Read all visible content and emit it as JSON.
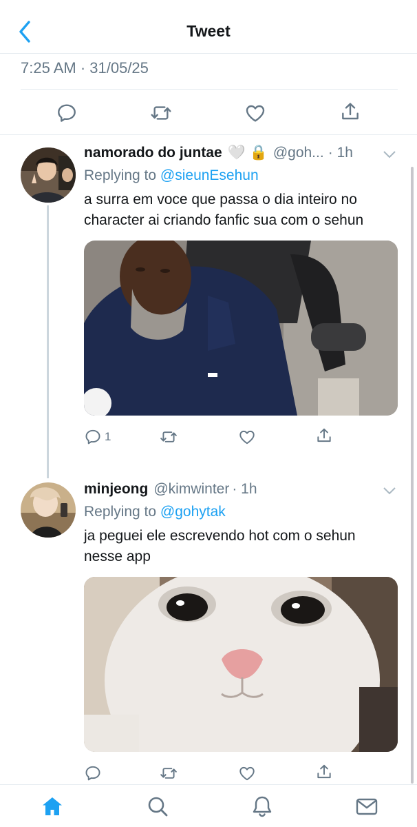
{
  "header": {
    "title": "Tweet"
  },
  "tweet": {
    "timestamp": "7:25 AM · 31/05/25"
  },
  "replies": [
    {
      "name": "namorado do juntae",
      "badges": "🤍 🔒",
      "handle": "@goh...",
      "time": "· 1h",
      "replying_label": "Replying to",
      "replying_to": "@sieunEsehun",
      "text": "a surra em voce que passa o dia inteiro no character ai criando fanfic sua com o sehun",
      "reply_count": "1"
    },
    {
      "name": "minjeong",
      "handle": "@kimwinter",
      "time": "· 1h",
      "replying_label": "Replying to",
      "replying_to": "@gohytak",
      "text": "ja peguei ele escrevendo hot com o sehun nesse app",
      "reply_count": ""
    }
  ],
  "colors": {
    "accent": "#1da1f2",
    "secondary": "#657786",
    "divider": "#e6ecf0"
  },
  "icons": [
    "back-chevron-icon",
    "reply-icon",
    "retweet-icon",
    "like-icon",
    "share-icon",
    "chevron-down-icon",
    "home-icon",
    "search-icon",
    "notifications-icon",
    "messages-icon"
  ]
}
